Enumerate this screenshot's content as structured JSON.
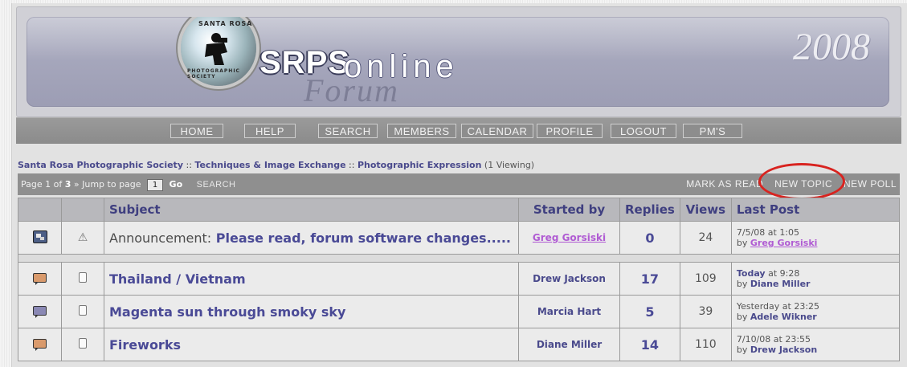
{
  "banner": {
    "logo_ring_top": "SANTA ROSA",
    "logo_ring_bottom": "PHOTOGRAPHIC SOCIETY",
    "srps": "SRPS",
    "online": "online",
    "forum": "Forum",
    "year": "2008"
  },
  "nav": [
    "HOME",
    "HELP",
    "SEARCH",
    "MEMBERS",
    "CALENDAR",
    "PROFILE",
    "LOGOUT",
    "PM'S"
  ],
  "breadcrumb": {
    "items": [
      "Santa Rosa Photographic Society",
      "Techniques & Image Exchange",
      "Photographic Expression"
    ],
    "separator": "::",
    "viewing": "(1 Viewing)"
  },
  "pagebar": {
    "page_prefix": "Page 1 of",
    "page_total": "3",
    "jump_text": "» Jump to page",
    "page_input": "1",
    "go": "Go",
    "search": "SEARCH",
    "mark_as_read": "MARK AS READ",
    "new_topic": "NEW TOPIC",
    "new_poll": "NEW POLL"
  },
  "table": {
    "headers": {
      "subject": "Subject",
      "started_by": "Started by",
      "replies": "Replies",
      "views": "Views",
      "last_post": "Last Post"
    },
    "announcement": {
      "prefix": "Announcement:",
      "title": "Please read, forum software changes.....",
      "started_by": "Greg Gorsiski",
      "replies": "0",
      "views": "24",
      "last_time": "7/5/08 at 1:05",
      "last_by_prefix": "by",
      "last_by": "Greg Gorsiski"
    },
    "rows": [
      {
        "title": "Thailand / Vietnam",
        "started_by": "Drew Jackson",
        "replies": "17",
        "views": "109",
        "last_day": "Today",
        "last_time": "at 9:28",
        "last_by_prefix": "by",
        "last_by": "Diane Miller",
        "icon_color": "#d99a6c"
      },
      {
        "title": "Magenta sun through smoky sky",
        "started_by": "Marcia Hart",
        "replies": "5",
        "views": "39",
        "last_day": "Yesterday",
        "last_time": "at 23:25",
        "last_by_prefix": "by",
        "last_by": "Adele Wikner",
        "icon_color": "#8a88b4"
      },
      {
        "title": "Fireworks",
        "started_by": "Diane Miller",
        "replies": "14",
        "views": "110",
        "last_day": "7/10/08",
        "last_time": "at 23:55",
        "last_by_prefix": "by",
        "last_by": "Drew Jackson",
        "icon_color": "#d99a6c"
      }
    ]
  },
  "colors": {
    "highlight_ellipse": "#d8231f",
    "link_purple": "#b05bd3",
    "header_text": "#3f3f80"
  },
  "icons": {
    "hot_topic": "speech-bubble-icon",
    "topic_doc": "document-icon",
    "warning": "warning-triangle-icon",
    "announcement": "announcement-icon"
  }
}
